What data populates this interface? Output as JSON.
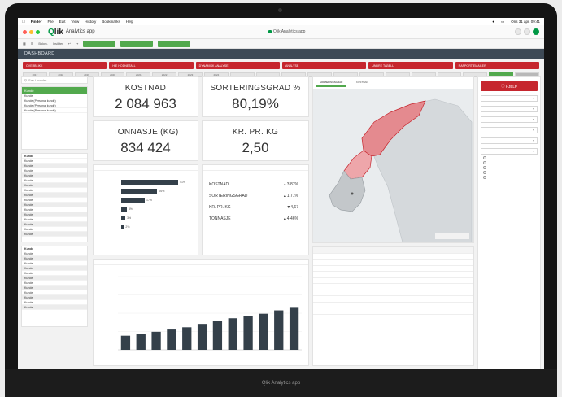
{
  "menubar": {
    "items": [
      "Finder",
      "File",
      "Edit",
      "View",
      "History",
      "Bookmarks",
      "Help"
    ],
    "clock": "Ons 31 apr. 09:41"
  },
  "app": {
    "logo_q": "Q",
    "logo_rest": "lik",
    "name": "Analytics app",
    "center_title": "Qlik Analytics app"
  },
  "toolbar": {
    "items": [
      "Bokm.",
      "Insikter"
    ]
  },
  "dashboard": {
    "title": "DASHBOARD"
  },
  "nav_buttons": [
    "OVERBLIKK",
    "HIE HODNETALL",
    "DYNAMISK ANALYSE",
    "ANALYSE",
    "UNDRE TABELL",
    "RAPPORT EMAILER"
  ],
  "periods": [
    "2017",
    "2018",
    "2019",
    "2020",
    "2021",
    "2022",
    "2023",
    "2024",
    "",
    "",
    "",
    "",
    "",
    "",
    "",
    "",
    "",
    "",
    "",
    ""
  ],
  "left": {
    "search_placeholder": "Søk i kunder",
    "list1_head": "Kunde",
    "list1_rows": [
      "Kunde",
      "Kunde (Personal kunde)",
      "Kunde (Personal kunde)",
      "Kunde (Personal kunde)"
    ],
    "list2_head": "Kunde",
    "list2_rows": [
      "Kunde",
      "Kunde",
      "Kunde",
      "Kunde",
      "Kunde",
      "Kunde",
      "Kunde",
      "Kunde",
      "Kunde",
      "Kunde",
      "Kunde",
      "Kunde",
      "Kunde",
      "Kunde",
      "Kunde",
      "Kunde"
    ],
    "list3_head": "Kunde",
    "list3_rows": [
      "Kunde",
      "Kunde",
      "Kunde",
      "Kunde",
      "Kunde",
      "Kunde",
      "Kunde",
      "Kunde",
      "Kunde",
      "Kunde",
      "Kunde",
      "Kunde"
    ]
  },
  "kpis": {
    "kostnad_label": "KOSTNAD",
    "kostnad_value": "2 084 963",
    "sort_label": "SORTERINGSGRAD %",
    "sort_value": "80,19%",
    "tonn_label": "TONNASJE (KG)",
    "tonn_value": "834 424",
    "krkg_label": "KR. PR. KG",
    "krkg_value": "2,50"
  },
  "changes": {
    "rows": [
      {
        "label": "KOSTNAD",
        "value": "▲3,87%"
      },
      {
        "label": "SORTERINGSGRAD",
        "value": "▲1,71%"
      },
      {
        "label": "KR. PR. KG",
        "value": "▼4,67"
      },
      {
        "label": "TONNASJE",
        "value": "▲4,46%"
      }
    ]
  },
  "chart_data": [
    {
      "type": "bar",
      "orientation": "horizontal",
      "categories": [
        "",
        "",
        "",
        "",
        "",
        ""
      ],
      "values": [
        41,
        26,
        17,
        4,
        3,
        2
      ],
      "value_labels": [
        "41%",
        "26%",
        "17%",
        "4%",
        "3%",
        "2%"
      ]
    },
    {
      "type": "bar",
      "categories": [
        "",
        "",
        "",
        "",
        "",
        "",
        "",
        "",
        "",
        "",
        "",
        ""
      ],
      "values": [
        25,
        28,
        32,
        36,
        40,
        46,
        52,
        56,
        60,
        64,
        70,
        76
      ],
      "ylim": [
        0,
        130
      ]
    }
  ],
  "map_tabs": [
    "SORTERINGSGRAD",
    "KOSTNAD",
    "",
    "",
    ""
  ],
  "table": {
    "columns": [
      "",
      "",
      "",
      "",
      ""
    ],
    "rows": [
      [
        "",
        "",
        "",
        "",
        ""
      ],
      [
        "",
        "",
        "",
        "",
        ""
      ],
      [
        "",
        "",
        "",
        "",
        ""
      ],
      [
        "",
        "",
        "",
        "",
        ""
      ],
      [
        "",
        "",
        "",
        "",
        ""
      ],
      [
        "",
        "",
        "",
        "",
        ""
      ],
      [
        "",
        "",
        "",
        "",
        ""
      ],
      [
        "",
        "",
        "",
        "",
        ""
      ],
      [
        "",
        "",
        "",
        "",
        ""
      ],
      [
        "",
        "",
        "",
        "",
        ""
      ]
    ]
  },
  "right": {
    "hjelp": "HJELP",
    "filters": [
      {
        "label": "",
        "value": ""
      },
      {
        "label": "",
        "value": ""
      },
      {
        "label": "",
        "value": ""
      },
      {
        "label": "",
        "value": ""
      },
      {
        "label": "",
        "value": ""
      },
      {
        "label": "",
        "value": ""
      }
    ]
  },
  "chin_text": "Qlik Analytics app",
  "colors": {
    "qlik_green": "#009845",
    "red": "#c6262e",
    "bar_dark": "#34404a",
    "sel_green": "#52a94d"
  }
}
